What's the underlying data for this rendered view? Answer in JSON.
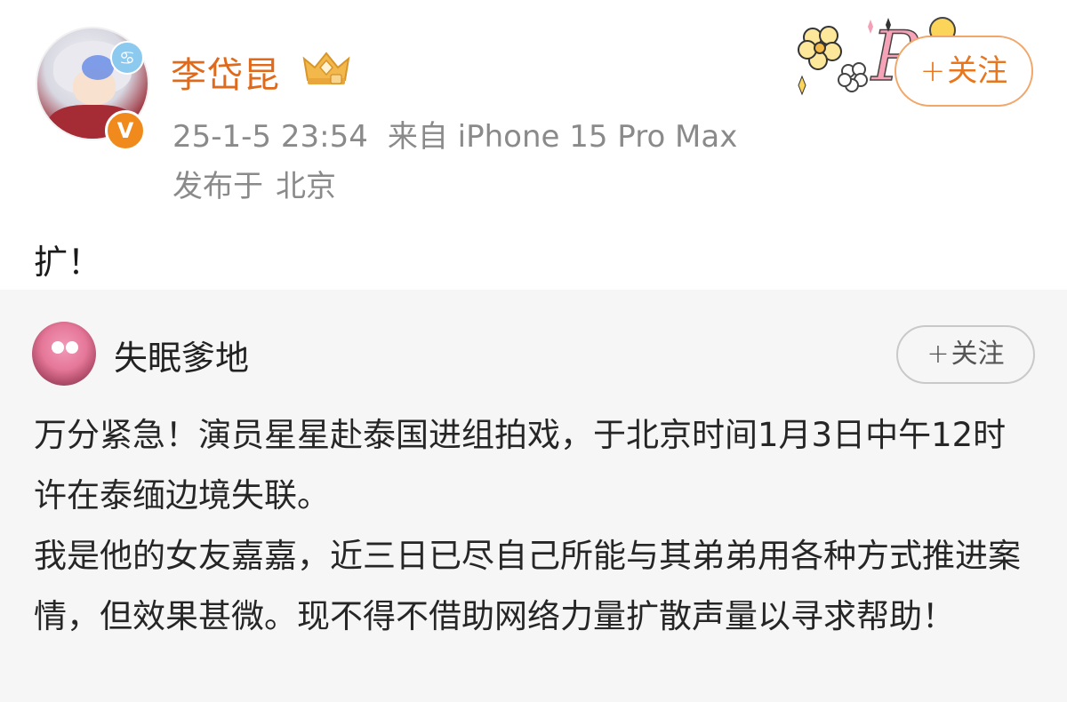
{
  "post": {
    "author": "李岱昆",
    "timestamp": "25-1-5 23:54",
    "source": "来自 iPhone 15 Pro Max",
    "location_prefix": "发布于",
    "location": "北京",
    "follow_plus": "+",
    "follow_label": "关注",
    "text": "扩！",
    "verified_mark": "V",
    "zodiac_glyph": "♋",
    "sticker_letter": "P",
    "colors": {
      "name": "#e06a1b",
      "follow": "#e8761e",
      "verified": "#f08a1c"
    }
  },
  "repost": {
    "author": "失眠爹地",
    "follow_plus": "+",
    "follow_label": "关注",
    "paragraphs": [
      "万分紧急！演员星星赴泰国进组拍戏，于北京时间1月3日中午12时许在泰缅边境失联。",
      "我是他的女友嘉嘉，近三日已尽自己所能与其弟弟用各种方式推进案情，但效果甚微。现不得不借助网络力量扩散声量以寻求帮助！"
    ]
  },
  "icons": [
    "avatar",
    "flower-icon",
    "zodiac-cancer-icon",
    "verified-badge-icon",
    "crown-badge-icon",
    "sticker-decoration",
    "plus-icon"
  ]
}
